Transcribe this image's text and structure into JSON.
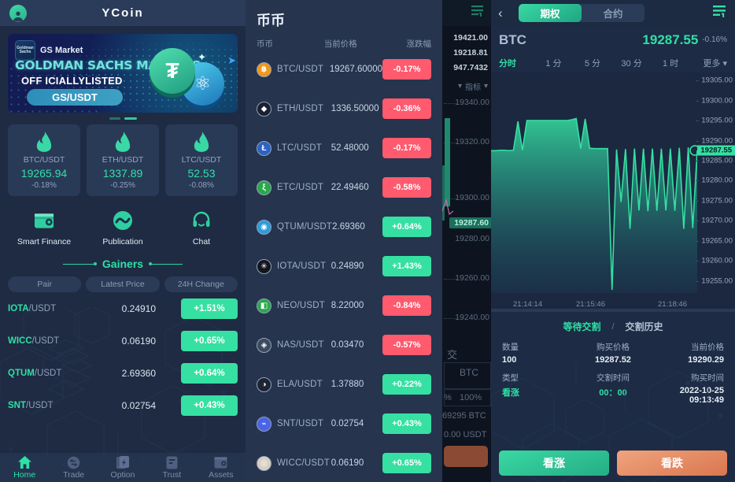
{
  "panel_home": {
    "header": {
      "title": "YCoin",
      "avatar_icon": "user-avatar-icon"
    },
    "banner": {
      "brand": "GS Market",
      "badge_text": "Goldman Sachs",
      "headline": "GOLDMAN SACHS MARKETS",
      "subline": "OFF ICIALLYLISTED",
      "pill": "GS/USDT",
      "coin1_symbol": "₮",
      "coin2_symbol": "⚛"
    },
    "price_cards": [
      {
        "pair": "BTC/USDT",
        "price": "19265.94",
        "change": "-0.18%"
      },
      {
        "pair": "ETH/USDT",
        "price": "1337.89",
        "change": "-0.25%"
      },
      {
        "pair": "LTC/USDT",
        "price": "52.53",
        "change": "-0.08%"
      }
    ],
    "quick_actions": [
      {
        "label": "Smart Finance",
        "icon": "wallet-icon"
      },
      {
        "label": "Publication",
        "icon": "publication-icon"
      },
      {
        "label": "Chat",
        "icon": "headset-icon"
      }
    ],
    "gainers": {
      "title": "Gainers",
      "columns": [
        "Pair",
        "Latest Price",
        "24H Change"
      ],
      "rows": [
        {
          "base": "IOTA",
          "quote": "/USDT",
          "price": "0.24910",
          "change": "+1.51%"
        },
        {
          "base": "WICC",
          "quote": "/USDT",
          "price": "0.06190",
          "change": "+0.65%"
        },
        {
          "base": "QTUM",
          "quote": "/USDT",
          "price": "2.69360",
          "change": "+0.64%"
        },
        {
          "base": "SNT",
          "quote": "/USDT",
          "price": "0.02754",
          "change": "+0.43%"
        }
      ]
    },
    "tabbar": [
      {
        "label": "Home",
        "icon": "home-icon",
        "active": true
      },
      {
        "label": "Trade",
        "icon": "trade-swap-icon",
        "active": false
      },
      {
        "label": "Option",
        "icon": "option-icon",
        "active": false
      },
      {
        "label": "Trust",
        "icon": "trust-doc-icon",
        "active": false
      },
      {
        "label": "Assets",
        "icon": "assets-wallet-icon",
        "active": false
      }
    ]
  },
  "panel_market": {
    "title": "币币",
    "columns": {
      "name": "币币",
      "price": "当前价格",
      "change": "涨跌幅"
    },
    "rows": [
      {
        "name": "BTC/USDT",
        "price": "19267.60000",
        "change": "-0.17%",
        "dir": "down",
        "sym": "฿",
        "color": "#f0971c"
      },
      {
        "name": "ETH/USDT",
        "price": "1336.50000",
        "change": "-0.36%",
        "dir": "down",
        "sym": "◆",
        "color": "#1b2030"
      },
      {
        "name": "LTC/USDT",
        "price": "52.48000",
        "change": "-0.17%",
        "dir": "down",
        "sym": "Ł",
        "color": "#2c63c4"
      },
      {
        "name": "ETC/USDT",
        "price": "22.49460",
        "change": "-0.58%",
        "dir": "down",
        "sym": "ξ",
        "color": "#2aa84a"
      },
      {
        "name": "QTUM/USDT",
        "price": "2.69360",
        "change": "+0.64%",
        "dir": "up",
        "sym": "◉",
        "color": "#2d9cdb"
      },
      {
        "name": "IOTA/USDT",
        "price": "0.24890",
        "change": "+1.43%",
        "dir": "up",
        "sym": "✳",
        "color": "#13161d"
      },
      {
        "name": "NEO/USDT",
        "price": "8.22000",
        "change": "-0.84%",
        "dir": "down",
        "sym": "◧",
        "color": "#2aa84a"
      },
      {
        "name": "NAS/USDT",
        "price": "0.03470",
        "change": "-0.57%",
        "dir": "down",
        "sym": "◈",
        "color": "#3c4a5f"
      },
      {
        "name": "ELA/USDT",
        "price": "1.37880",
        "change": "+0.22%",
        "dir": "up",
        "sym": "◑",
        "color": "#1d2433"
      },
      {
        "name": "SNT/USDT",
        "price": "0.02754",
        "change": "+0.43%",
        "dir": "up",
        "sym": "⌁",
        "color": "#4b63e6"
      },
      {
        "name": "WICC/USDT",
        "price": "0.06190",
        "change": "+0.65%",
        "dir": "up",
        "sym": "◎",
        "color": "#d8cfc1"
      }
    ]
  },
  "panel_trade_partial": {
    "menu_icon": "list-menu-icon",
    "stats": [
      "19421.00",
      "19218.81",
      "947.7432"
    ],
    "indicator_label": "指标",
    "axis_labels": [
      "19340.00",
      "19320.00",
      "19300.00",
      "19280.00",
      "19260.00",
      "19240.00"
    ],
    "highlight_price": "19287.60",
    "unit_label": "BTC",
    "percent_label": "100%",
    "balance": "69295 BTC",
    "amount": "0.00 USDT"
  },
  "panel_option": {
    "header": {
      "back_icon": "chevron-left-icon",
      "tabs": [
        {
          "label": "期权",
          "active": true
        },
        {
          "label": "合约",
          "active": false
        }
      ],
      "menu_icon": "list-menu-icon"
    },
    "symbol": {
      "name": "BTC",
      "price": "19287.55",
      "change": "-0.16%"
    },
    "timeframes": [
      "分时",
      "1 分",
      "5 分",
      "30 分",
      "1 时",
      "更多"
    ],
    "order_tabs": {
      "pending": "等待交割",
      "sep": "/",
      "history": "交割历史"
    },
    "order": {
      "qty_label": "数量",
      "qty_value": "100",
      "buy_price_label": "购买价格",
      "buy_price_value": "19287.52",
      "cur_price_label": "当前价格",
      "cur_price_value": "19290.29",
      "type_label": "类型",
      "type_value": "看涨",
      "settle_label": "交割时间",
      "settle_value": "00：00",
      "buy_time_label": "购买时间",
      "buy_time_value": "2022-10-25 09:13:49"
    },
    "actions": {
      "up": "看涨",
      "down": "看跌"
    },
    "colors": {
      "up": "#35e0a2",
      "down": "#e08a5f",
      "accent": "#2fe0a5"
    }
  },
  "chart_data": {
    "type": "area",
    "title": "BTC 分时",
    "xlabel": "",
    "ylabel": "",
    "ylim": [
      19252,
      19307
    ],
    "grid": false,
    "legend": "none",
    "y_ticks": [
      "19305.00",
      "19300.00",
      "19295.00",
      "19290.00",
      "19285.00",
      "19280.00",
      "19275.00",
      "19270.00",
      "19265.00",
      "19260.00",
      "19255.00"
    ],
    "x_ticks": [
      "21:14:14",
      "21:15:46",
      "21:18:46"
    ],
    "current_marker": "19287.55",
    "series": [
      {
        "name": "BTC price",
        "values": [
          19287.5,
          19287.5,
          19287.6,
          19287.6,
          19287.5,
          19287.6,
          19294.8,
          19287.6,
          19295.0,
          19295.0,
          19295.0,
          19295.0,
          19295.0,
          19295.0,
          19295.0,
          19295.0,
          19295.0,
          19295.0,
          19295.2,
          19295.5,
          19288.0,
          19295.4,
          19288.1,
          19288.0,
          19288.0,
          19288.0,
          19288.0,
          19252.8,
          19287.8,
          19274.7,
          19287.9,
          19268.0,
          19288.0,
          19272.6,
          19288.0,
          19272.4,
          19288.0,
          19272.5,
          19288.0,
          19272.6,
          19288.0,
          19272.5,
          19288.2,
          19268.0,
          19288.3,
          19268.2,
          19287.55
        ]
      }
    ]
  }
}
